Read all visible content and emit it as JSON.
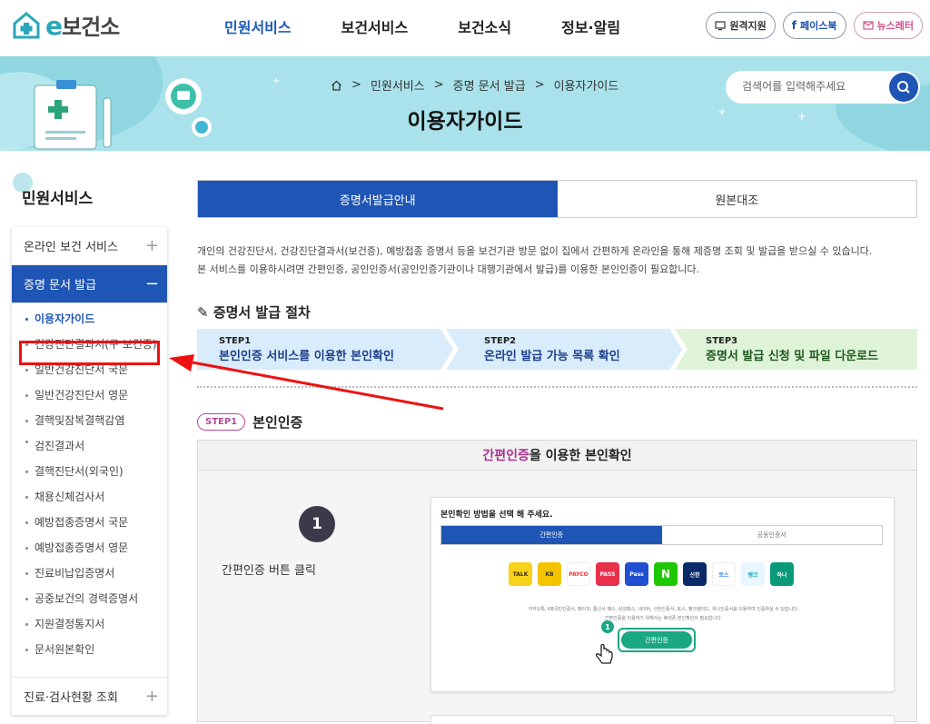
{
  "header": {
    "logo_text": "보건소",
    "logo_e": "e",
    "nav": [
      "민원서비스",
      "보건서비스",
      "보건소식",
      "정보·알림"
    ],
    "util": [
      "원격지원",
      "페이스북",
      "뉴스레터"
    ]
  },
  "banner": {
    "breadcrumb": [
      "민원서비스",
      "증명 문서 발급",
      "이용자가이드"
    ],
    "title": "이용자가이드",
    "search_placeholder": "검색어를 입력해주세요"
  },
  "sidebar": {
    "title": "민원서비스",
    "group1": "온라인 보건 서비스",
    "group2": "증명 문서 발급",
    "items": [
      "이용자가이드",
      "건강진단결과서(구 보건증)",
      "일반건강진단서 국문",
      "일반건강진단서 영문",
      "결핵및잠복결핵감염",
      "검진결과서",
      "결핵진단서(외국인)",
      "채용신체검사서",
      "예방접종증명서 국문",
      "예방접종증명서 영문",
      "진료비납입증명서",
      "공중보건의 경력증명서",
      "지원결정통지서",
      "문서원본확인"
    ],
    "group3": "진료·검사현황 조회"
  },
  "tabs": [
    "증명서발급안내",
    "원본대조"
  ],
  "intro": [
    "개인의 건강진단서, 건강진단결과서(보건증), 예방접종 증명서 등을 보건기관 방문 없이 집에서 간편하게 온라인을 통해 제증명 조회 및 발급을 받으실 수 있습니다.",
    "본 서비스를 이용하시려면 간편인증, 공인인증서(공인인증기관이나 대행기관에서 발급)를 이용한 본인인증이 필요합니다."
  ],
  "process": {
    "title": "증명서 발급 절차",
    "steps": [
      {
        "step": "STEP1",
        "desc": "본인인증 서비스를 이용한 본인확인"
      },
      {
        "step": "STEP2",
        "desc": "온라인 발급 가능 목록 확인"
      },
      {
        "step": "STEP3",
        "desc": "증명서 발급 신청 및 파일 다운로드"
      }
    ]
  },
  "section": {
    "pill": "STEP1",
    "heading": "본인인증",
    "card_head_kw": "간편인증",
    "card_head_rest": "을 이용한 본인확인",
    "number": "1",
    "caption": "간편인증 버튼 클릭",
    "shot": {
      "title": "본인확인 방법을 선택 해 주세요.",
      "tabs": [
        "간편인증",
        "공동인증서"
      ],
      "apps": [
        "TALK",
        "KB",
        "PAYCO",
        "PASS",
        "Pass",
        "N",
        "신한",
        "토스",
        "뱅크",
        "하나"
      ],
      "note1": "카카오톡, KB국민인증서, 페이코, 통신사 패스, 삼성패스, 네이버, 신한인증서, 토스, 뱅크샐러드, 하나인증서를 이용하여 인증하실 수 있습니다.",
      "note2": "간편인증을 이용하기 위해서는 휴대폰 본인확인이 필요합니다.",
      "button": "간편인증",
      "badge": "1"
    }
  },
  "colors": {
    "primary": "#1f55b5",
    "banner": "#a9e2ea",
    "highlight": "#e11111"
  }
}
